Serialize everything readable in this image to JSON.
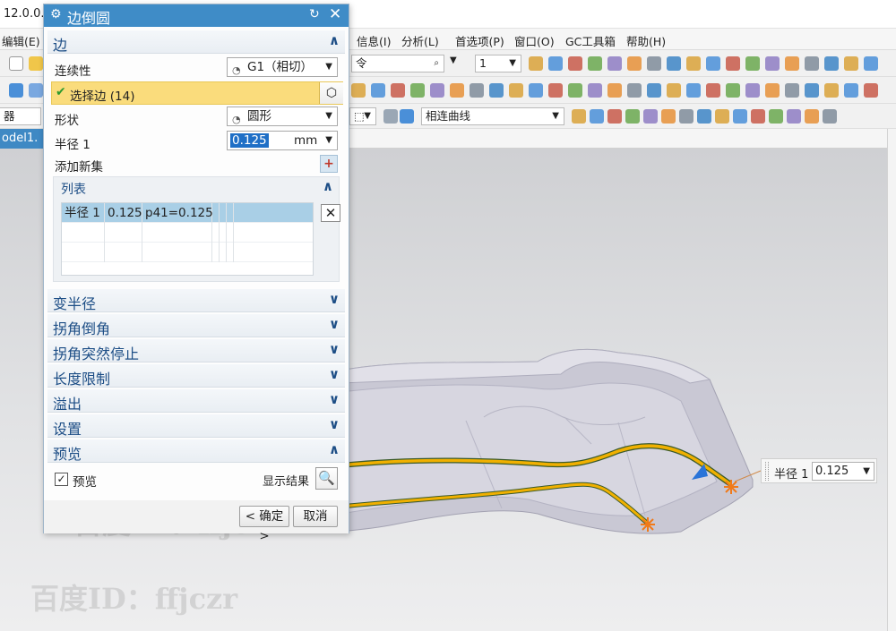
{
  "app": {
    "title": "12.0.0.",
    "menu": [
      "编辑(E)",
      "信息(I)",
      "分析(L)",
      "首选项(P)",
      "窗口(O)",
      "GC工具箱",
      "帮助(H)"
    ],
    "command_search_text": "令",
    "layer_value": "1",
    "curve_rule_value": "相连曲线",
    "filter_label": "器",
    "model_tab": "odel1."
  },
  "dialog": {
    "title": "边倒圆",
    "edge_section": {
      "title": "边",
      "continuity_label": "连续性",
      "continuity_value": "G1（相切）",
      "select_edge_label": "选择边 (14)",
      "shape_label": "形状",
      "shape_value": "圆形",
      "radius_label": "半径 1",
      "radius_value": "0.125",
      "radius_unit": "mm",
      "add_set_label": "添加新集"
    },
    "list_section": {
      "title": "列表",
      "rows": [
        {
          "c1": "半径 1",
          "c2": "0.125",
          "c3": "p41=0.125"
        }
      ]
    },
    "collapsed_sections": [
      "变半径",
      "拐角倒角",
      "拐角突然停止",
      "长度限制",
      "溢出",
      "设置"
    ],
    "preview_section": {
      "title": "预览",
      "preview_checkbox_label": "预览",
      "preview_checked": true,
      "show_result_label": "显示结果"
    },
    "buttons": {
      "ok": "< 确定 >",
      "cancel": "取消"
    }
  },
  "viewport": {
    "radius_callout_label": "半径 1",
    "radius_callout_value": "0.125"
  },
  "watermark": "百度ID：ffjczr",
  "colors": {
    "title_blue": "#3f8cc7",
    "selection_yellow": "#fadc7c",
    "edge_highlight": "#f0b000"
  }
}
